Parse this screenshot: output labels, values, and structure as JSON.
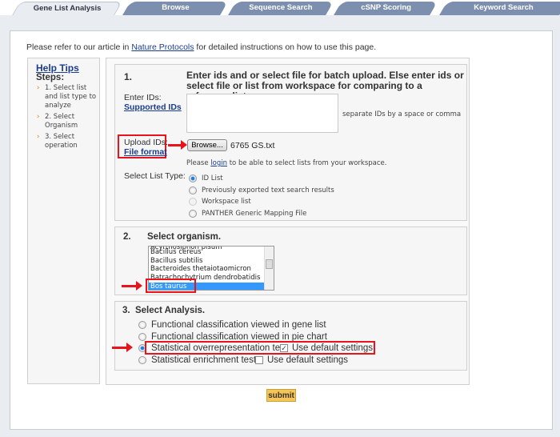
{
  "tabs": [
    {
      "label": "Gene List Analysis",
      "active": true
    },
    {
      "label": "Browse"
    },
    {
      "label": "Sequence Search"
    },
    {
      "label": "cSNP Scoring"
    },
    {
      "label": "Keyword Search"
    }
  ],
  "intro": {
    "prefix": "Please refer to our article in ",
    "link": "Nature Protocols",
    "suffix": " for detailed instructions on how to use this page."
  },
  "sidebar": {
    "help_tips": "Help Tips",
    "steps_label": "Steps:",
    "steps": [
      "1. Select list and list type to analyze",
      "2. Select Organism",
      "3. Select operation"
    ]
  },
  "section1": {
    "number": "1.",
    "heading": "Enter ids and or select file for batch upload. Else enter ids or select file or list from workspace for comparing to a reference list.",
    "enter_ids_label": "Enter IDs:",
    "supported_ids_link": "Supported IDs",
    "ids_value": "",
    "ids_hint": "separate IDs by a space or comma",
    "upload_label": "Upload IDs:",
    "file_format_link": "File format",
    "browse_button": "Browse...",
    "file_name": "6765 GS.txt",
    "login_prefix": "Please ",
    "login_link": "login",
    "login_suffix": " to be able to select lists from your workspace.",
    "list_type_label": "Select List Type:",
    "list_types": [
      {
        "label": "ID List",
        "selected": true
      },
      {
        "label": "Previously exported text search results"
      },
      {
        "label": "Workspace list",
        "disabled": true
      },
      {
        "label": "PANTHER Generic Mapping File"
      }
    ]
  },
  "section2": {
    "number": "2.",
    "heading": "Select organism.",
    "organisms": [
      "Bacillus cereus",
      "Bacillus subtilis",
      "Bacteroides thetaiotaomicron",
      "Batrachochytrium dendrobatidis",
      "Bos taurus"
    ],
    "selected": "Bos taurus"
  },
  "section3": {
    "heading": "3.  Select Analysis.",
    "options": [
      {
        "label": "Functional classification viewed in gene list"
      },
      {
        "label": "Functional classification viewed in pie chart"
      },
      {
        "label": "Statistical overrepresentation test",
        "selected": true,
        "default_settings": "Use default settings",
        "default_checked": true
      },
      {
        "label": "Statistical enrichment test",
        "default_settings": "Use default settings",
        "default_checked": false
      }
    ]
  },
  "submit": "submit",
  "colors": {
    "highlight": "#e8131b",
    "selection": "#3399ff",
    "tab": "#7d8fae",
    "submit": "#f7c553"
  }
}
